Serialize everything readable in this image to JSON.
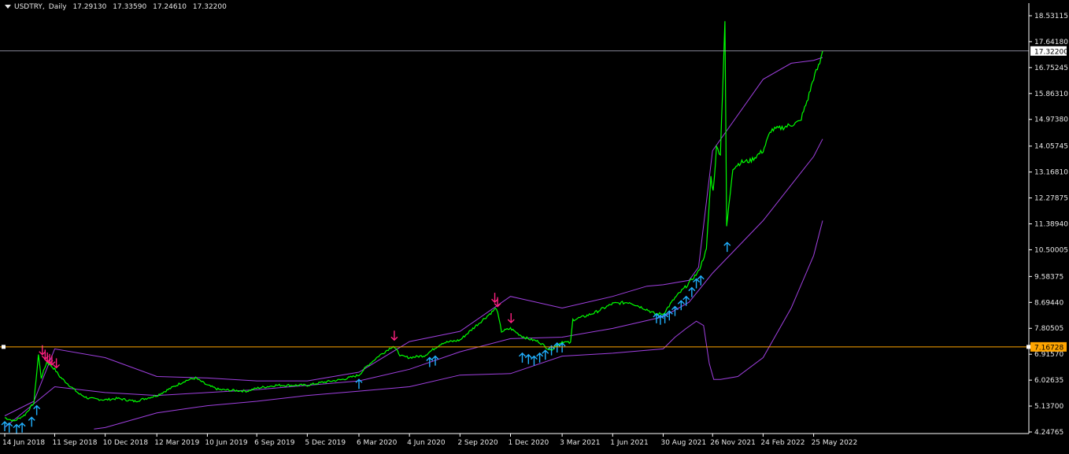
{
  "header": {
    "symbol": "USDTRY",
    "timeframe": "Daily",
    "open": "17.29130",
    "high": "17.33590",
    "low": "17.24610",
    "close": "17.32200"
  },
  "colors": {
    "background": "#000000",
    "price_line": "#00ff00",
    "bands": "#a040e0",
    "sell_arrow": "#ff2080",
    "buy_arrow": "#20b0ff",
    "axis": "#ffffff",
    "current_price_line": "#b4b4c8",
    "horizontal_level": "#ffa500",
    "level_label_bg": "#ffa500"
  },
  "chart_data": {
    "type": "line",
    "title": "USDTRY,Daily",
    "y_ticks": [
      "18.53115",
      "17.64180",
      "16.75245",
      "15.86310",
      "14.97380",
      "14.05745",
      "13.16810",
      "12.27875",
      "11.38940",
      "10.50005",
      "9.58375",
      "8.69440",
      "7.80505",
      "6.91570",
      "6.02635",
      "5.13700",
      "4.24765"
    ],
    "x_ticks": [
      "14 Jun 2018",
      "11 Sep 2018",
      "10 Dec 2018",
      "12 Mar 2019",
      "10 Jun 2019",
      "6 Sep 2019",
      "5 Dec 2019",
      "6 Mar 2020",
      "4 Jun 2020",
      "2 Sep 2020",
      "1 Dec 2020",
      "3 Mar 2021",
      "1 Jun 2021",
      "30 Aug 2021",
      "26 Nov 2021",
      "24 Feb 2022",
      "25 May 2022"
    ],
    "ylim": [
      4.1,
      19.0
    ],
    "current_price_label": "17.32200",
    "current_price": 17.322,
    "level_label": "7.16728",
    "level_value": 7.16728,
    "series": [
      {
        "key": "price",
        "values": [
          [
            "14 Jun 2018",
            4.74
          ],
          [
            "1 Jul 2018",
            4.62
          ],
          [
            "20 Jul 2018",
            4.84
          ],
          [
            "5 Aug 2018",
            5.25
          ],
          [
            "13 Aug 2018",
            6.9
          ],
          [
            "18 Aug 2018",
            6.1
          ],
          [
            "28 Aug 2018",
            6.65
          ],
          [
            "11 Sep 2018",
            6.4
          ],
          [
            "20 Sep 2018",
            6.15
          ],
          [
            "10 Oct 2018",
            5.8
          ],
          [
            "25 Oct 2018",
            5.55
          ],
          [
            "10 Nov 2018",
            5.4
          ],
          [
            "10 Dec 2018",
            5.35
          ],
          [
            "1 Jan 2019",
            5.4
          ],
          [
            "1 Feb 2019",
            5.3
          ],
          [
            "12 Mar 2019",
            5.5
          ],
          [
            "1 Apr 2019",
            5.7
          ],
          [
            "1 May 2019",
            6.0
          ],
          [
            "20 May 2019",
            6.1
          ],
          [
            "10 Jun 2019",
            5.85
          ],
          [
            "1 Jul 2019",
            5.7
          ],
          [
            "20 Aug 2019",
            5.65
          ],
          [
            "6 Sep 2019",
            5.75
          ],
          [
            "10 Oct 2019",
            5.85
          ],
          [
            "5 Dec 2019",
            5.85
          ],
          [
            "1 Jan 2020",
            5.95
          ],
          [
            "6 Feb 2020",
            6.05
          ],
          [
            "6 Mar 2020",
            6.2
          ],
          [
            "20 Mar 2020",
            6.5
          ],
          [
            "10 Apr 2020",
            6.85
          ],
          [
            "6 May 2020",
            7.2
          ],
          [
            "20 May 2020",
            6.85
          ],
          [
            "4 Jun 2020",
            6.8
          ],
          [
            "1 Jul 2020",
            6.87
          ],
          [
            "1 Aug 2020",
            7.3
          ],
          [
            "2 Sep 2020",
            7.4
          ],
          [
            "1 Oct 2020",
            7.9
          ],
          [
            "25 Oct 2020",
            8.3
          ],
          [
            "6 Nov 2020",
            8.5
          ],
          [
            "15 Nov 2020",
            7.7
          ],
          [
            "1 Dec 2020",
            7.8
          ],
          [
            "20 Dec 2020",
            7.55
          ],
          [
            "1 Jan 2021",
            7.45
          ],
          [
            "20 Jan 2021",
            7.35
          ],
          [
            "10 Feb 2021",
            7.05
          ],
          [
            "3 Mar 2021",
            7.35
          ],
          [
            "18 Mar 2021",
            7.3
          ],
          [
            "22 Mar 2021",
            8.1
          ],
          [
            "10 Apr 2021",
            8.2
          ],
          [
            "1 May 2021",
            8.35
          ],
          [
            "1 Jun 2021",
            8.65
          ],
          [
            "1 Jul 2021",
            8.7
          ],
          [
            "1 Aug 2021",
            8.45
          ],
          [
            "15 Aug 2021",
            8.3
          ],
          [
            "30 Aug 2021",
            8.3
          ],
          [
            "20 Sep 2021",
            8.85
          ],
          [
            "10 Oct 2021",
            9.25
          ],
          [
            "1 Nov 2021",
            9.75
          ],
          [
            "15 Nov 2021",
            10.5
          ],
          [
            "23 Nov 2021",
            13.0
          ],
          [
            "27 Nov 2021",
            12.5
          ],
          [
            "3 Dec 2021",
            14.0
          ],
          [
            "10 Dec 2021",
            13.8
          ],
          [
            "18 Dec 2021",
            18.36
          ],
          [
            "21 Dec 2021",
            11.3
          ],
          [
            "25 Dec 2021",
            12.0
          ],
          [
            "1 Jan 2022",
            13.3
          ],
          [
            "15 Jan 2022",
            13.5
          ],
          [
            "1 Feb 2022",
            13.55
          ],
          [
            "24 Feb 2022",
            13.9
          ],
          [
            "10 Mar 2022",
            14.6
          ],
          [
            "1 Apr 2022",
            14.7
          ],
          [
            "1 May 2022",
            14.9
          ],
          [
            "15 May 2022",
            15.7
          ],
          [
            "25 May 2022",
            16.4
          ],
          [
            "5 Jun 2022",
            16.9
          ],
          [
            "10 Jun 2022",
            17.32
          ]
        ]
      },
      {
        "key": "upper_band",
        "values": [
          [
            "14 Jun 2018",
            4.8
          ],
          [
            "5 Aug 2018",
            5.3
          ],
          [
            "11 Sep 2018",
            7.1
          ],
          [
            "10 Dec 2018",
            6.8
          ],
          [
            "12 Mar 2019",
            6.15
          ],
          [
            "10 Jun 2019",
            6.1
          ],
          [
            "6 Sep 2019",
            6.0
          ],
          [
            "5 Dec 2019",
            6.0
          ],
          [
            "6 Mar 2020",
            6.3
          ],
          [
            "4 Jun 2020",
            7.35
          ],
          [
            "2 Sep 2020",
            7.7
          ],
          [
            "1 Dec 2020",
            8.9
          ],
          [
            "3 Mar 2021",
            8.5
          ],
          [
            "1 Jun 2021",
            8.9
          ],
          [
            "1 Aug 2021",
            9.25
          ],
          [
            "30 Aug 2021",
            9.3
          ],
          [
            "15 Oct 2021",
            9.45
          ],
          [
            "1 Nov 2021",
            9.9
          ],
          [
            "26 Nov 2021",
            13.9
          ],
          [
            "24 Feb 2022",
            16.35
          ],
          [
            "15 Apr 2022",
            16.9
          ],
          [
            "25 May 2022",
            17.0
          ],
          [
            "10 Jun 2022",
            17.1
          ]
        ]
      },
      {
        "key": "middle_band",
        "values": [
          [
            "14 Jun 2018",
            4.4
          ],
          [
            "11 Sep 2018",
            5.8
          ],
          [
            "10 Dec 2018",
            5.6
          ],
          [
            "12 Mar 2019",
            5.5
          ],
          [
            "10 Jun 2019",
            5.6
          ],
          [
            "6 Sep 2019",
            5.7
          ],
          [
            "5 Dec 2019",
            5.85
          ],
          [
            "6 Mar 2020",
            6.0
          ],
          [
            "4 Jun 2020",
            6.4
          ],
          [
            "2 Sep 2020",
            7.0
          ],
          [
            "1 Dec 2020",
            7.45
          ],
          [
            "3 Mar 2021",
            7.5
          ],
          [
            "1 Jun 2021",
            7.8
          ],
          [
            "30 Aug 2021",
            8.2
          ],
          [
            "15 Oct 2021",
            8.7
          ],
          [
            "26 Nov 2021",
            9.7
          ],
          [
            "24 Feb 2022",
            11.5
          ],
          [
            "25 May 2022",
            13.7
          ],
          [
            "10 Jun 2022",
            14.3
          ]
        ]
      },
      {
        "key": "lower_band",
        "values": [
          [
            "20 Nov 2018",
            4.35
          ],
          [
            "10 Dec 2018",
            4.4
          ],
          [
            "12 Mar 2019",
            4.9
          ],
          [
            "10 Jun 2019",
            5.15
          ],
          [
            "6 Sep 2019",
            5.3
          ],
          [
            "5 Dec 2019",
            5.5
          ],
          [
            "6 Mar 2020",
            5.65
          ],
          [
            "4 Jun 2020",
            5.8
          ],
          [
            "2 Sep 2020",
            6.2
          ],
          [
            "1 Dec 2020",
            6.25
          ],
          [
            "3 Mar 2021",
            6.85
          ],
          [
            "1 Jun 2021",
            6.95
          ],
          [
            "30 Aug 2021",
            7.1
          ],
          [
            "20 Sep 2021",
            7.5
          ],
          [
            "10 Oct 2021",
            7.8
          ],
          [
            "28 Oct 2021",
            8.05
          ],
          [
            "10 Nov 2021",
            7.9
          ],
          [
            "20 Nov 2021",
            6.6
          ],
          [
            "28 Nov 2021",
            6.05
          ],
          [
            "10 Dec 2021",
            6.05
          ],
          [
            "10 Jan 2022",
            6.15
          ],
          [
            "24 Feb 2022",
            6.8
          ],
          [
            "15 Apr 2022",
            8.5
          ],
          [
            "25 May 2022",
            10.3
          ],
          [
            "10 Jun 2022",
            11.5
          ]
        ]
      }
    ],
    "sell_arrows": [
      [
        "20 Aug 2018",
        6.9
      ],
      [
        "25 Aug 2018",
        6.75
      ],
      [
        "29 Aug 2018",
        6.65
      ],
      [
        "2 Sep 2018",
        6.6
      ],
      [
        "6 Sep 2018",
        6.55
      ],
      [
        "14 Sep 2018",
        6.45
      ],
      [
        "8 May 2020",
        7.4
      ],
      [
        "3 Nov 2020",
        8.7
      ],
      [
        "8 Nov 2020",
        8.55
      ],
      [
        "2 Dec 2020",
        8.0
      ]
    ],
    "buy_arrows": [
      [
        "14 Jun 2018",
        4.6
      ],
      [
        "22 Jun 2018",
        4.55
      ],
      [
        "5 Jul 2018",
        4.5
      ],
      [
        "15 Jul 2018",
        4.55
      ],
      [
        "1 Aug 2018",
        4.75
      ],
      [
        "10 Aug 2018",
        5.15
      ],
      [
        "6 Mar 2020",
        6.05
      ],
      [
        "10 Jul 2020",
        6.8
      ],
      [
        "20 Jul 2020",
        6.85
      ],
      [
        "22 Dec 2020",
        6.95
      ],
      [
        "2 Jan 2021",
        6.9
      ],
      [
        "12 Jan 2021",
        6.85
      ],
      [
        "22 Jan 2021",
        6.95
      ],
      [
        "1 Feb 2021",
        7.05
      ],
      [
        "12 Feb 2021",
        7.2
      ],
      [
        "22 Feb 2021",
        7.3
      ],
      [
        "3 Mar 2021",
        7.3
      ],
      [
        "18 Aug 2021",
        8.3
      ],
      [
        "25 Aug 2021",
        8.25
      ],
      [
        "2 Sep 2021",
        8.3
      ],
      [
        "10 Sep 2021",
        8.4
      ],
      [
        "20 Sep 2021",
        8.55
      ],
      [
        "1 Oct 2021",
        8.75
      ],
      [
        "10 Oct 2021",
        8.9
      ],
      [
        "20 Oct 2021",
        9.2
      ],
      [
        "28 Oct 2021",
        9.5
      ],
      [
        "5 Nov 2021",
        9.6
      ],
      [
        "22 Dec 2021",
        10.75
      ]
    ]
  }
}
